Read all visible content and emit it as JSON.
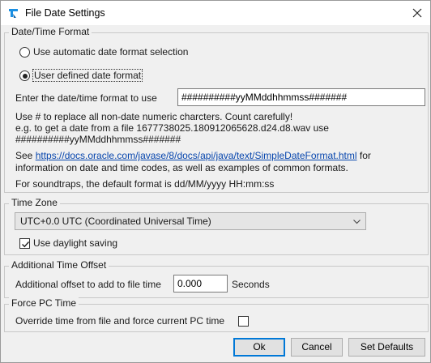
{
  "window": {
    "title": "File Date Settings",
    "icon": "app-logo-icon"
  },
  "date_time_format": {
    "section_title": "Date/Time Format",
    "auto_option_label": "Use automatic date format selection",
    "auto_selected": false,
    "user_option_label": "User defined date format",
    "user_selected": true,
    "format_label": "Enter the date/time format to use",
    "format_value": "##########yyMMddhhmmss#######",
    "help_line1": "Use # to replace all non-date numeric charcters. Count carefully!",
    "help_line2": "e.g. to get a date from a file 1677738025.180912065628.d24.d8.wav use",
    "help_line3": "##########yyMMddhhmmss#######",
    "see_prefix": "See ",
    "see_link": "https://docs.oracle.com/javase/8/docs/api/java/text/SimpleDateFormat.html",
    "see_suffix": " for",
    "see_line2": "information on date and time codes, as well as examples of common formats.",
    "soundtraps_note": "For soundtraps, the default format is dd/MM/yyyy HH:mm:ss"
  },
  "time_zone": {
    "section_title": "Time Zone",
    "selected_zone": "UTC+0.0 UTC (Coordinated Universal Time)",
    "daylight_label": "Use daylight saving",
    "daylight_checked": true
  },
  "additional_offset": {
    "section_title": "Additional Time Offset",
    "label": "Additional offset to add to file time",
    "value": "0.000",
    "unit": "Seconds"
  },
  "force_pc_time": {
    "section_title": "Force PC Time",
    "label": "Override time from file and force current PC time",
    "checked": false
  },
  "buttons": {
    "ok": "Ok",
    "cancel": "Cancel",
    "defaults": "Set Defaults"
  },
  "colors": {
    "link": "#0645ad",
    "default_button_border": "#0078d7",
    "logo_blue": "#1a8fe3"
  }
}
